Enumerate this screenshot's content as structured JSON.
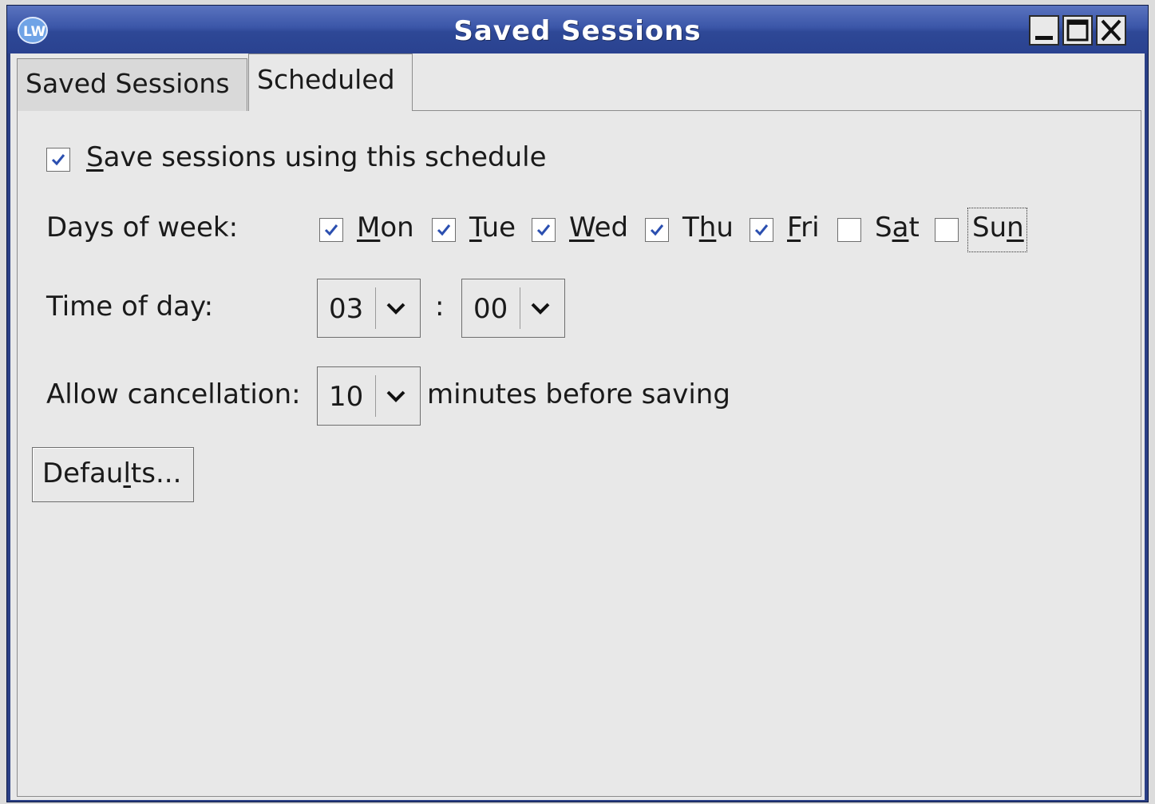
{
  "window": {
    "title": "Saved Sessions",
    "app_icon": "lw-app-icon",
    "controls": [
      "minimize-icon",
      "maximize-icon",
      "close-icon"
    ]
  },
  "tabs": [
    {
      "label": "Saved Sessions",
      "selected": false
    },
    {
      "label": "Scheduled",
      "selected": true
    }
  ],
  "schedule": {
    "enable_label_first": "S",
    "enable_label_rest": "ave sessions using this schedule",
    "enable_checked": true,
    "days_label": "Days of week:",
    "days": [
      {
        "pre": "",
        "u": "M",
        "post": "on",
        "checked": true
      },
      {
        "pre": "",
        "u": "T",
        "post": "ue",
        "checked": true
      },
      {
        "pre": "",
        "u": "W",
        "post": "ed",
        "checked": true
      },
      {
        "pre": "T",
        "u": "h",
        "post": "u",
        "checked": true
      },
      {
        "pre": "",
        "u": "F",
        "post": "ri",
        "checked": true
      },
      {
        "pre": "S",
        "u": "a",
        "post": "t",
        "checked": false
      },
      {
        "pre": "Su",
        "u": "n",
        "post": "",
        "checked": false
      }
    ],
    "time_label": "Time of day:",
    "hour": "03",
    "time_separator": ":",
    "minute": "00",
    "cancel_label": "Allow cancellation:",
    "cancel_minutes": "10",
    "cancel_suffix": "minutes before saving",
    "defaults_pre": "Defau",
    "defaults_u": "l",
    "defaults_post": "ts..."
  },
  "colors": {
    "titlebar": "#3b56a8",
    "check": "#2b4fb0",
    "panel_bg": "#e8e8e8"
  }
}
